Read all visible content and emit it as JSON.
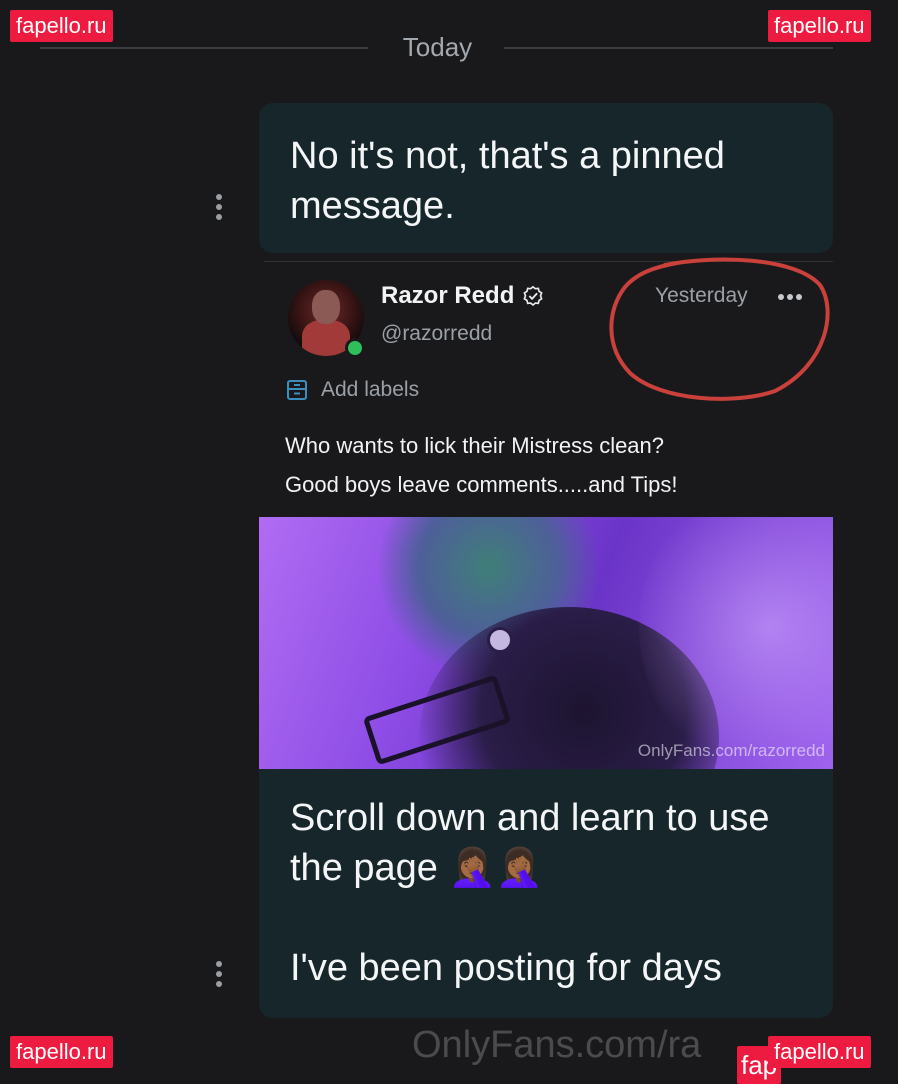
{
  "watermarks": [
    "fapello.ru",
    "fapello.ru",
    "fapello.ru",
    "fapello.ru",
    "fap"
  ],
  "date_divider": "Today",
  "messages": {
    "first": "No it's not, that's a pinned message.",
    "second_line1": "Scroll down and learn to use",
    "second_line2": "the page",
    "second_emoji": "🤦🏾‍♀️🤦🏾‍♀️",
    "second_line3": "I've been posting for days"
  },
  "post": {
    "author_name": "Razor Redd",
    "author_handle": "@razorredd",
    "timestamp": "Yesterday",
    "add_labels": "Add labels",
    "text_line1": "Who wants to lick their Mistress clean?",
    "text_line2": "Good boys leave comments.....and Tips!",
    "image_watermark": "OnlyFans.com/razorredd"
  },
  "footer_watermark": "OnlyFans.com/ra",
  "colors": {
    "bubble": "#16262b",
    "accent_watermark": "#ed1b3f",
    "online": "#2fbe5a",
    "annotation_circle": "#c9413a"
  }
}
